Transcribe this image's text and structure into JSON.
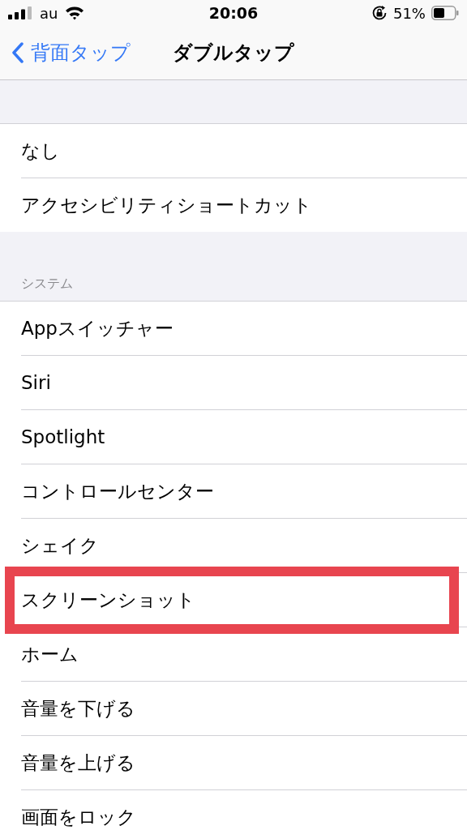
{
  "status_bar": {
    "carrier": "au",
    "time": "20:06",
    "battery_percent": "51%"
  },
  "nav_bar": {
    "back_label": "背面タップ",
    "title": "ダブルタップ"
  },
  "sections": [
    {
      "items": [
        {
          "label": "なし",
          "highlighted": false
        },
        {
          "label": "アクセシビリティショートカット",
          "highlighted": false
        }
      ]
    },
    {
      "header": "システム",
      "items": [
        {
          "label": "Appスイッチャー",
          "highlighted": false
        },
        {
          "label": "Siri",
          "highlighted": false
        },
        {
          "label": "Spotlight",
          "highlighted": false
        },
        {
          "label": "コントロールセンター",
          "highlighted": false
        },
        {
          "label": "シェイク",
          "highlighted": false
        },
        {
          "label": "スクリーンショット",
          "highlighted": true
        },
        {
          "label": "ホーム",
          "highlighted": false
        },
        {
          "label": "音量を下げる",
          "highlighted": false
        },
        {
          "label": "音量を上げる",
          "highlighted": false
        },
        {
          "label": "画面をロック",
          "highlighted": false
        }
      ]
    }
  ]
}
